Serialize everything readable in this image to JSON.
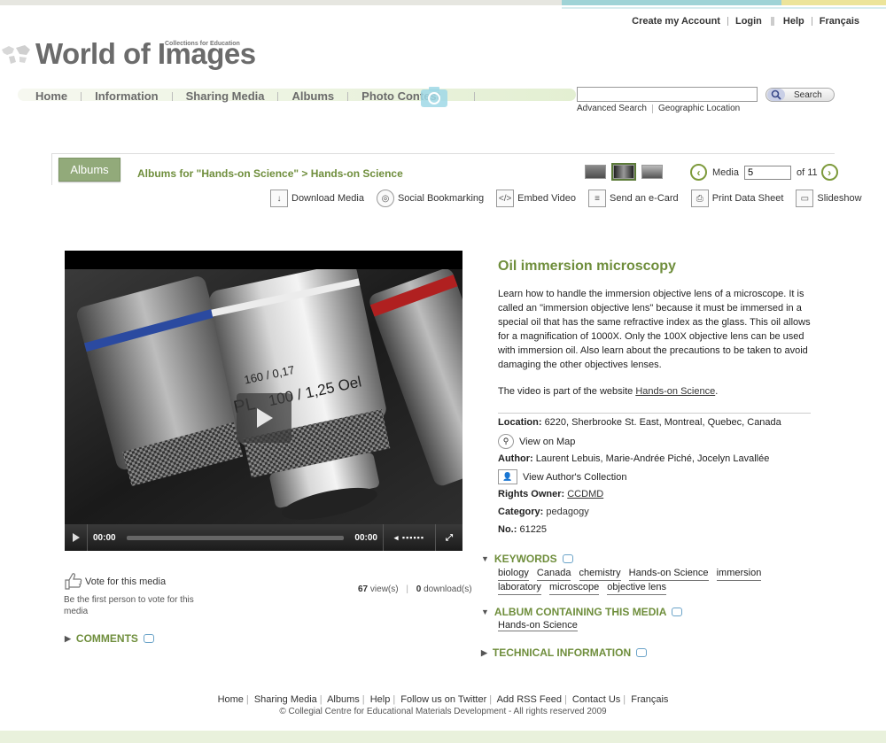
{
  "header": {
    "top_links": [
      "Create my Account",
      "Login",
      "Help",
      "Français"
    ],
    "logo_title": "World of Images",
    "logo_subtitle": "Collections for Education"
  },
  "nav": {
    "items": [
      "Home",
      "Information",
      "Sharing Media",
      "Albums",
      "Photo Contest"
    ]
  },
  "search": {
    "value": "",
    "button_label": "Search",
    "links": [
      "Advanced Search",
      "Geographic Location"
    ]
  },
  "album_bar": {
    "tab_label": "Albums",
    "breadcrumb": "Albums for \"Hands-on Science\" > Hands-on Science",
    "media_label": "Media",
    "media_value": "5",
    "of_total": "of 11"
  },
  "toolbar": {
    "items": [
      "Download Media",
      "Social Bookmarking",
      "Embed Video",
      "Send an e-Card",
      "Print Data Sheet",
      "Slideshow"
    ]
  },
  "player": {
    "current_time": "00:00",
    "duration": "00:00",
    "progress": 0,
    "lens_text_1": "160 / 0,17",
    "lens_text_2": "PL",
    "lens_text_3": "100 / 1,25 Oel"
  },
  "vote": {
    "label": "Vote for this media",
    "note": "Be the first person to vote for this media"
  },
  "stats": {
    "views": "67",
    "views_label": "view(s)",
    "downloads": "0",
    "downloads_label": "download(s)"
  },
  "comments": {
    "heading": "COMMENTS"
  },
  "media": {
    "title": "Oil immersion microscopy",
    "description": "Learn how to handle the immersion objective lens of a microscope. It is called an \"immersion objective lens\" because it must be immersed in a special oil that has the same refractive index as the glass. This oil allows for a magnification of 1000X. Only the 100X objective lens can be used with immersion oil. Also learn about the precautions to be taken to avoid damaging the other objectives lenses.",
    "part_of_prefix": "The video is part of the website ",
    "part_of_link": "Hands-on Science",
    "part_of_suffix": "."
  },
  "meta": {
    "location_label": "Location:",
    "location_value": "6220, Sherbrooke St. East, Montreal, Quebec, Canada",
    "view_map": "View on Map",
    "author_label": "Author:",
    "author_value": "Laurent Lebuis, Marie-Andrée Piché, Jocelyn Lavallée",
    "view_author_collection": "View Author's Collection",
    "rights_label": "Rights Owner:",
    "rights_value": "CCDMD",
    "category_label": "Category:",
    "category_value": "pedagogy",
    "number_label": "No.:",
    "number_value": "61225"
  },
  "keywords": {
    "heading": "KEYWORDS",
    "tags": [
      "biology",
      "Canada",
      "chemistry",
      "Hands-on Science",
      "immersion",
      "laboratory",
      "microscope",
      "objective lens"
    ]
  },
  "album_section": {
    "heading": "ALBUM CONTAINING THIS MEDIA",
    "link": "Hands-on Science"
  },
  "technical": {
    "heading": "TECHNICAL INFORMATION"
  },
  "footer": {
    "links": [
      "Home",
      "Sharing Media",
      "Albums",
      "Help",
      "Follow us on Twitter",
      "Add RSS Feed",
      "Contact Us",
      "Français"
    ],
    "copyright": "© Collegial Centre for Educational Materials Development - All rights reserved 2009"
  },
  "colors": {
    "accent_green": "#6f8e3c",
    "tab_green": "#92aa7a",
    "stripe_teal": "#9fd3d6",
    "stripe_yellow": "#ece49a"
  }
}
